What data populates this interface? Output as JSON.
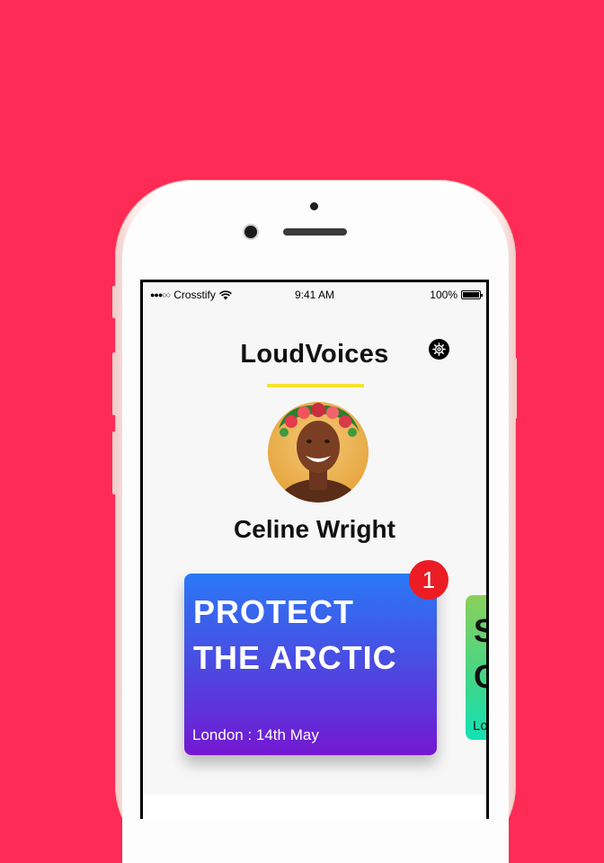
{
  "status_bar": {
    "carrier": "Crosstify",
    "time": "9:41 AM",
    "battery": "100%"
  },
  "header": {
    "title": "LoudVoices",
    "accent_color": "#f5e32f"
  },
  "profile": {
    "name": "Celine Wright"
  },
  "cards": [
    {
      "title_lines": [
        "PROTECT",
        "THE ARCTIC"
      ],
      "subtitle": "London : 14th May",
      "badge": "1"
    },
    {
      "title_lines": [
        "S",
        "C"
      ],
      "subtitle": "Lo"
    }
  ],
  "icons": [
    "signal-dots-icon",
    "wifi-icon",
    "battery-icon",
    "gear-icon"
  ],
  "colors": {
    "background": "#fd2b55",
    "card_gradient_top": "#2a79f6",
    "card_gradient_bottom": "#7418d2",
    "badge": "#ec1c24"
  }
}
